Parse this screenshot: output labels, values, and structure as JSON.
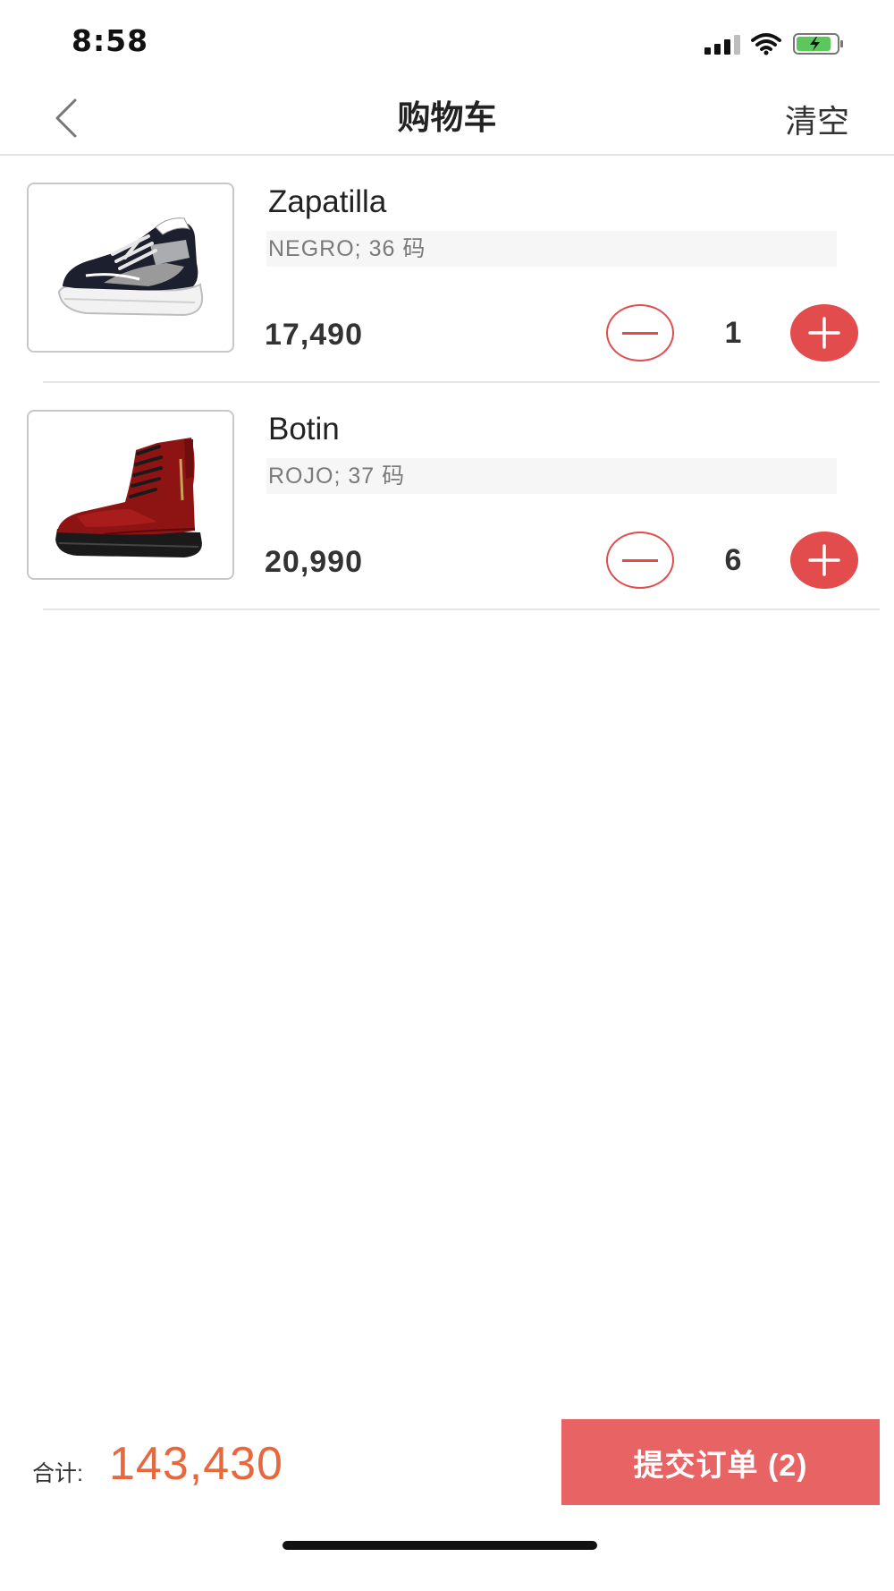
{
  "status_bar": {
    "time": "8:58",
    "icons": [
      "cellular-signal-icon",
      "wifi-icon",
      "battery-charging-icon"
    ]
  },
  "nav": {
    "back_icon": "chevron-left-icon",
    "title": "购物车",
    "clear_label": "清空"
  },
  "cart": {
    "items": [
      {
        "name": "Zapatilla",
        "variant": "NEGRO; 36 码",
        "price": "17,490",
        "quantity": "1",
        "image": "sneaker-image"
      },
      {
        "name": "Botin",
        "variant": "ROJO; 37 码",
        "price": "20,990",
        "quantity": "6",
        "image": "boot-image"
      }
    ]
  },
  "footer": {
    "total_label": "合计:",
    "total_value": "143,430",
    "submit_label": "提交订单 (2)"
  },
  "colors": {
    "accent_red": "#e34c4c",
    "submit_bg": "#e86363",
    "total_orange": "#e8673c"
  }
}
